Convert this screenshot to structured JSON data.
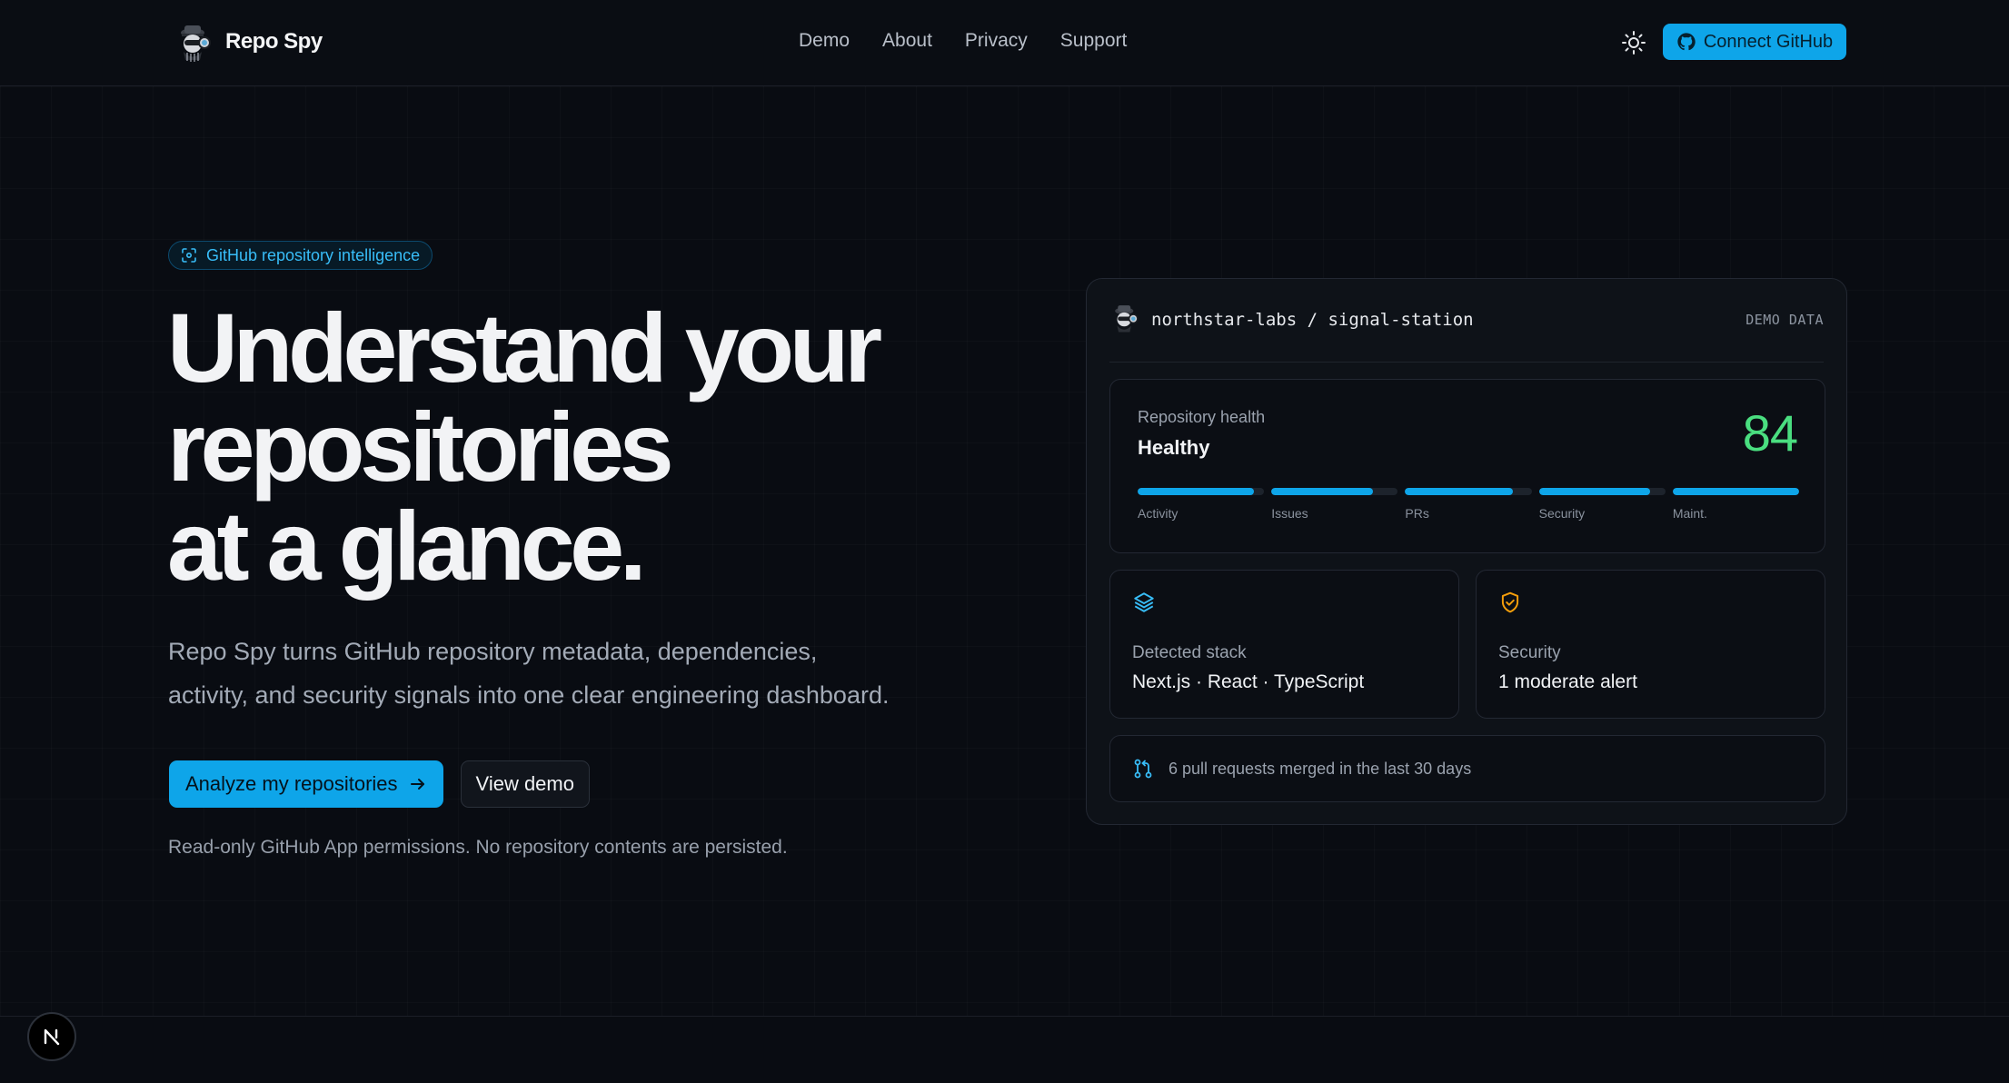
{
  "nav": {
    "brand": "Repo Spy",
    "links": [
      "Demo",
      "About",
      "Privacy",
      "Support"
    ],
    "connect_label": "Connect GitHub",
    "theme_icon": "sun-icon"
  },
  "hero": {
    "pill": "GitHub repository intelligence",
    "title_lines": [
      "Understand your",
      "repositories",
      "at a glance."
    ],
    "subtitle_lines": [
      "Repo Spy turns GitHub repository metadata, dependencies,",
      "activity, and security signals into one clear engineering dashboard."
    ],
    "primary_cta": "Analyze my repositories",
    "secondary_cta": "View demo",
    "fineprint": "Read-only GitHub App permissions. No repository contents are persisted."
  },
  "demo": {
    "repo": "northstar-labs / signal-station",
    "tag": "DEMO DATA",
    "health": {
      "label": "Repository health",
      "status": "Healthy",
      "score": "84",
      "score_color": "#4ade80",
      "metrics": [
        {
          "label": "Activity",
          "value": 0.92
        },
        {
          "label": "Issues",
          "value": 0.8
        },
        {
          "label": "PRs",
          "value": 0.85
        },
        {
          "label": "Security",
          "value": 0.88
        },
        {
          "label": "Maint.",
          "value": 1.0
        }
      ]
    },
    "stack": {
      "label": "Detected stack",
      "value": "Next.js · React · TypeScript",
      "icon": "layers-icon",
      "icon_color": "#38bdf8"
    },
    "security": {
      "label": "Security",
      "value": "1 moderate alert",
      "icon": "shield-check-icon",
      "icon_color": "#f59e0b"
    },
    "prs": {
      "text": "6 pull requests merged in the last 30 days",
      "icon": "git-pull-request-icon"
    }
  },
  "colors": {
    "accent": "#0ea5e9",
    "background": "#090c12"
  },
  "dev_badge": "N"
}
